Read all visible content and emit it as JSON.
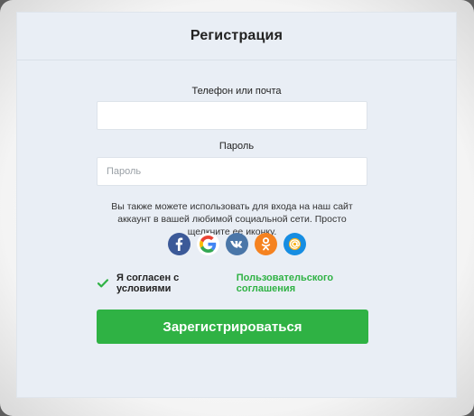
{
  "form": {
    "title": "Регистрация",
    "login_label": "Телефон или почта",
    "login_value": "",
    "login_placeholder": "",
    "password_label": "Пароль",
    "password_placeholder": "Пароль",
    "social_hint": "Вы также можете использовать для входа на наш сайт аккаунт в вашей любимой социальной сети. Просто щелкните ее иконку.",
    "socials": [
      {
        "name": "facebook",
        "icon": "facebook-icon",
        "color": "#3b5998"
      },
      {
        "name": "google",
        "icon": "google-icon",
        "color": "#ffffff"
      },
      {
        "name": "vk",
        "icon": "vk-icon",
        "color": "#4a76a8"
      },
      {
        "name": "odnoklassniki",
        "icon": "odnoklassniki-icon",
        "color": "#f58220"
      },
      {
        "name": "mail",
        "icon": "mail-at-icon",
        "color": "#168de2"
      }
    ],
    "agree_text": "Я согласен с условиями",
    "agree_link": "Пользовательского соглашения",
    "agree_checked": true,
    "submit_label": "Зарегистрироваться"
  },
  "colors": {
    "accent": "#2fb244",
    "card_bg": "#e9eef5"
  }
}
